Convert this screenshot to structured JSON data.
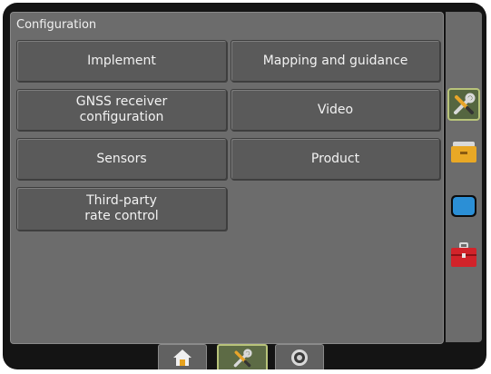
{
  "title": "Configuration",
  "buttons": {
    "implement": "Implement",
    "mapping": "Mapping and guidance",
    "gnss_line1": "GNSS receiver",
    "gnss_line2": "configuration",
    "video": "Video",
    "sensors": "Sensors",
    "product": "Product",
    "thirdparty_line1": "Third-party",
    "thirdparty_line2": "rate control"
  },
  "side_tabs": [
    {
      "icon": "wrench-screwdriver-icon",
      "selected": true
    },
    {
      "icon": "folder-icon",
      "selected": false
    },
    {
      "icon": "monitor-icon",
      "selected": false
    },
    {
      "icon": "toolbox-icon",
      "selected": false
    }
  ],
  "bottom_tabs": [
    {
      "icon": "home-icon",
      "selected": false
    },
    {
      "icon": "wrench-screwdriver-icon",
      "selected": true
    },
    {
      "icon": "camera-icon",
      "selected": false
    }
  ],
  "colors": {
    "panel": "#6c6c6c",
    "button": "#5a5a5a",
    "selected_tab": "#556640",
    "accent": "#b8c37a"
  }
}
